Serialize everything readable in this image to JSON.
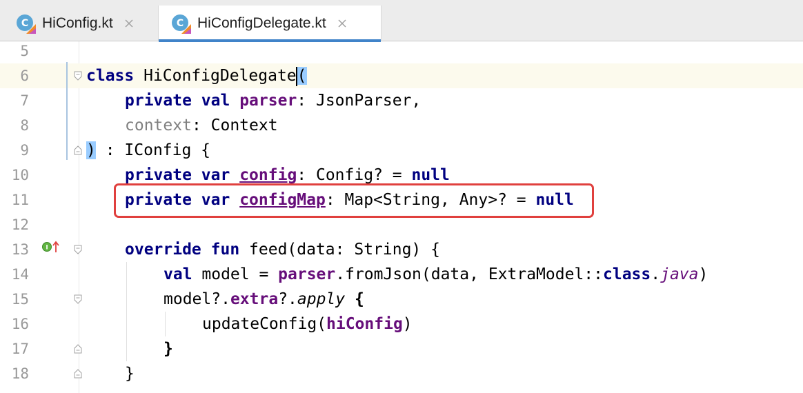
{
  "tabs": [
    {
      "label": "HiConfig.kt",
      "active": false
    },
    {
      "label": "HiConfigDelegate.kt",
      "active": true
    }
  ],
  "colors": {
    "keyword": "#000080",
    "property": "#660e7a",
    "unused_param": "#808080",
    "highlight_box": "#e0403e",
    "active_tab_underline": "#4083c9",
    "current_line": "#fcfaed"
  },
  "editor": {
    "current_line": 6,
    "line_numbers": [
      "5",
      "6",
      "7",
      "8",
      "9",
      "10",
      "11",
      "12",
      "13",
      "14",
      "15",
      "16",
      "17",
      "18"
    ],
    "lines": {
      "l6": {
        "kw": "class",
        "name": " HiConfigDelegate",
        "paren": "("
      },
      "l7": {
        "kw1": "private",
        "kw2": "val",
        "prop": "parser",
        "rest": ": JsonParser,"
      },
      "l8": {
        "param": "context",
        "rest": ": Context"
      },
      "l9": {
        "paren": ")",
        "rest": " : IConfig {"
      },
      "l10": {
        "kw1": "private",
        "kw2": "var",
        "prop": "config",
        "rest": ": Config? = ",
        "kw3": "null"
      },
      "l11": {
        "kw1": "private",
        "kw2": "var",
        "prop": "configMap",
        "rest": ": Map<String, Any>? = ",
        "kw3": "null"
      },
      "l13": {
        "kw1": "override",
        "kw2": "fun",
        "rest": " feed(data: String) {"
      },
      "l14": {
        "kw1": "val",
        "rest1": " model = ",
        "prop": "parser",
        "rest2": ".fromJson(data, ExtraModel::",
        "kw2": "class",
        "dot": ".",
        "it": "java",
        "end": ")"
      },
      "l15": {
        "rest1": "model?.",
        "prop": "extra",
        "rest2": "?.",
        "it": "apply",
        "brace": " {"
      },
      "l16": {
        "rest1": "updateConfig(",
        "prop": "hiConfig",
        "rest2": ")"
      },
      "l17": {
        "brace": "}"
      },
      "l18": {
        "brace": "}"
      }
    },
    "gutter_icons": [
      "override-implements-icon"
    ]
  }
}
